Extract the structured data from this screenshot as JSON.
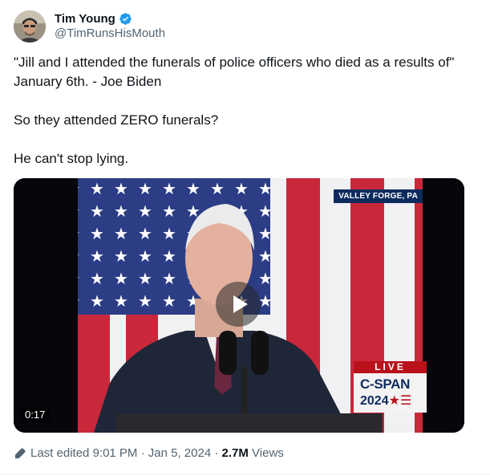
{
  "author": {
    "name": "Tim Young",
    "handle": "@TimRunsHisMouth",
    "verified": true
  },
  "tweet": {
    "paragraphs": [
      "\"Jill and I attended the funerals of police officers who died as a results of\" January 6th. - Joe Biden",
      "So they attended ZERO funerals?",
      "He can't stop lying."
    ]
  },
  "media": {
    "location_chyron": "VALLEY FORGE, PA",
    "network_live": "LIVE",
    "network_name": "C-SPAN",
    "network_year": "2024",
    "network_year_mark": "★☰",
    "duration": "0:17"
  },
  "meta": {
    "edited_label": "Last edited",
    "time": "9:01 PM",
    "separator": " · ",
    "date": "Jan 5, 2024",
    "views_count": "2.7M",
    "views_label": " Views"
  },
  "colors": {
    "verified": "#1d9bf0",
    "text": "#0f1419",
    "secondary": "#536471"
  }
}
